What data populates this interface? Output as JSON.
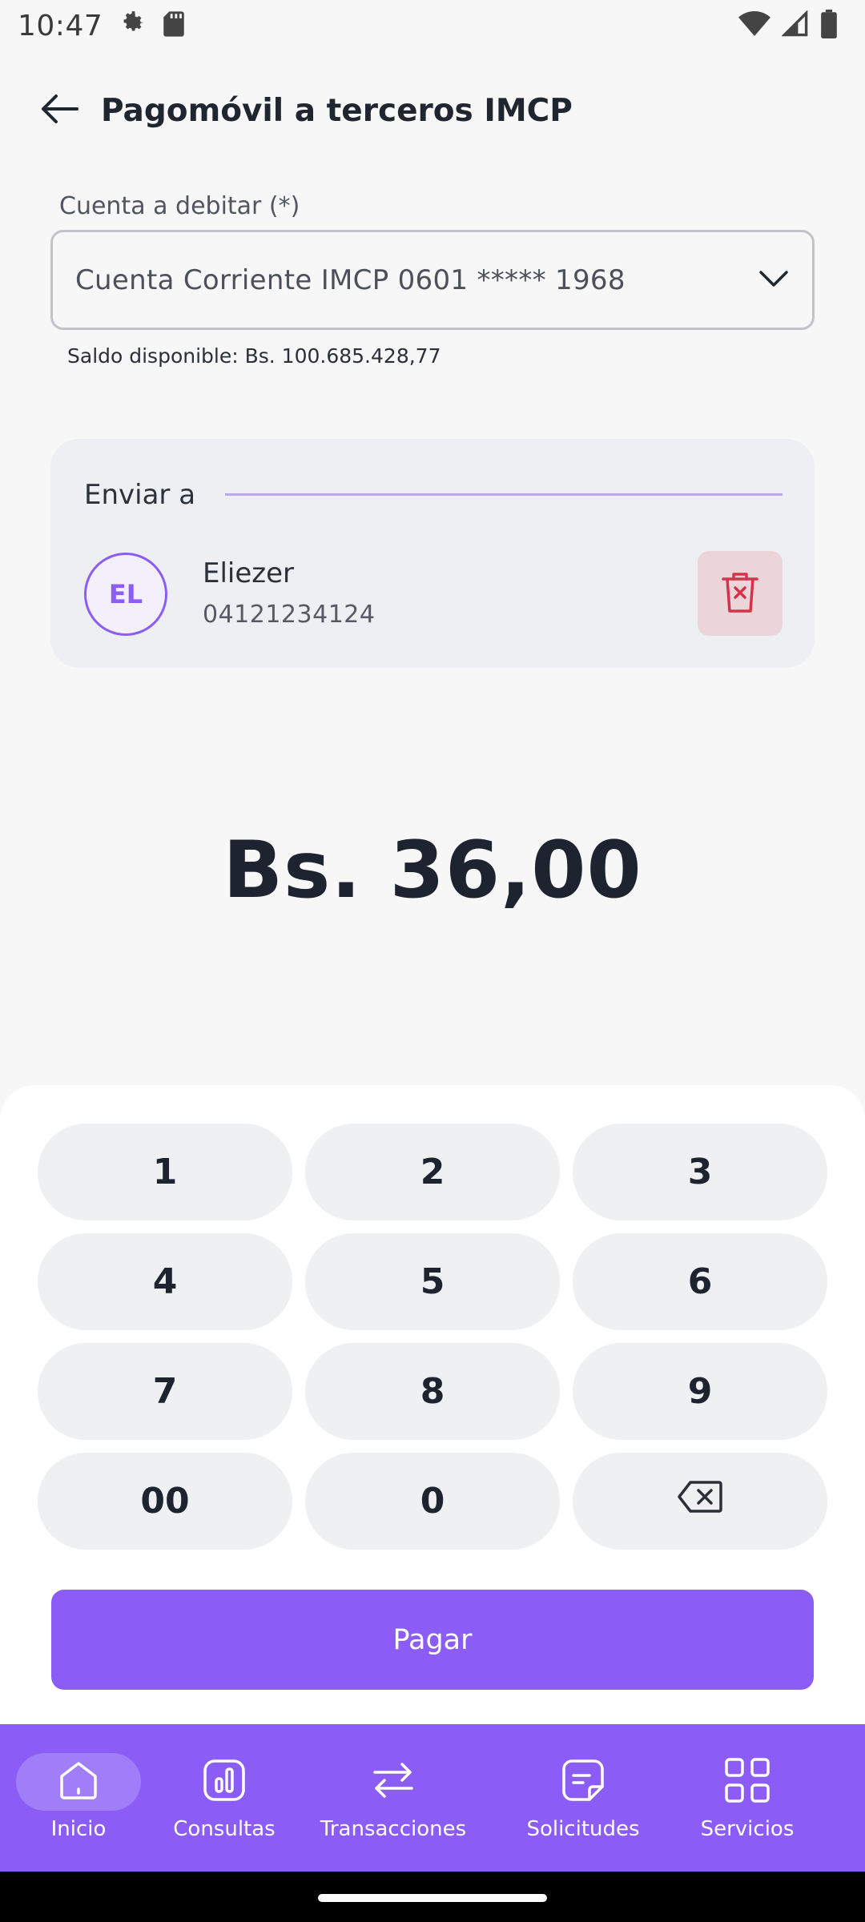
{
  "status_bar": {
    "time": "10:47",
    "icons_left": [
      "settings-icon",
      "sd-card-icon"
    ],
    "icons_right": [
      "wifi-icon",
      "signal-icon",
      "battery-icon"
    ]
  },
  "header": {
    "title": "Pagomóvil a terceros IMCP",
    "back_icon": "arrow-left-icon"
  },
  "account": {
    "label": "Cuenta a debitar (*)",
    "value": "Cuenta Corriente IMCP 0601 ***** 1968",
    "balance": "Saldo disponible: Bs. 100.685.428,77"
  },
  "recipient": {
    "section_label": "Enviar a",
    "initials": "EL",
    "name": "Eliezer",
    "phone": "04121234124"
  },
  "amount": "Bs. 36,00",
  "keypad": {
    "keys": [
      "1",
      "2",
      "3",
      "4",
      "5",
      "6",
      "7",
      "8",
      "9",
      "00",
      "0"
    ],
    "backspace_icon": "backspace-icon"
  },
  "pay_button": "Pagar",
  "bottom_nav": [
    {
      "label": "Inicio",
      "icon": "home-icon",
      "active": true
    },
    {
      "label": "Consultas",
      "icon": "chart-icon",
      "active": false
    },
    {
      "label": "Transacciones",
      "icon": "transfer-icon",
      "active": false
    },
    {
      "label": "Solicitudes",
      "icon": "document-icon",
      "active": false
    },
    {
      "label": "Servicios",
      "icon": "grid-icon",
      "active": false
    }
  ],
  "colors": {
    "accent": "#8b5cf6",
    "background": "#f7f7f8",
    "delete_bg": "#ecd5d8",
    "delete_icon": "#d6334a"
  }
}
